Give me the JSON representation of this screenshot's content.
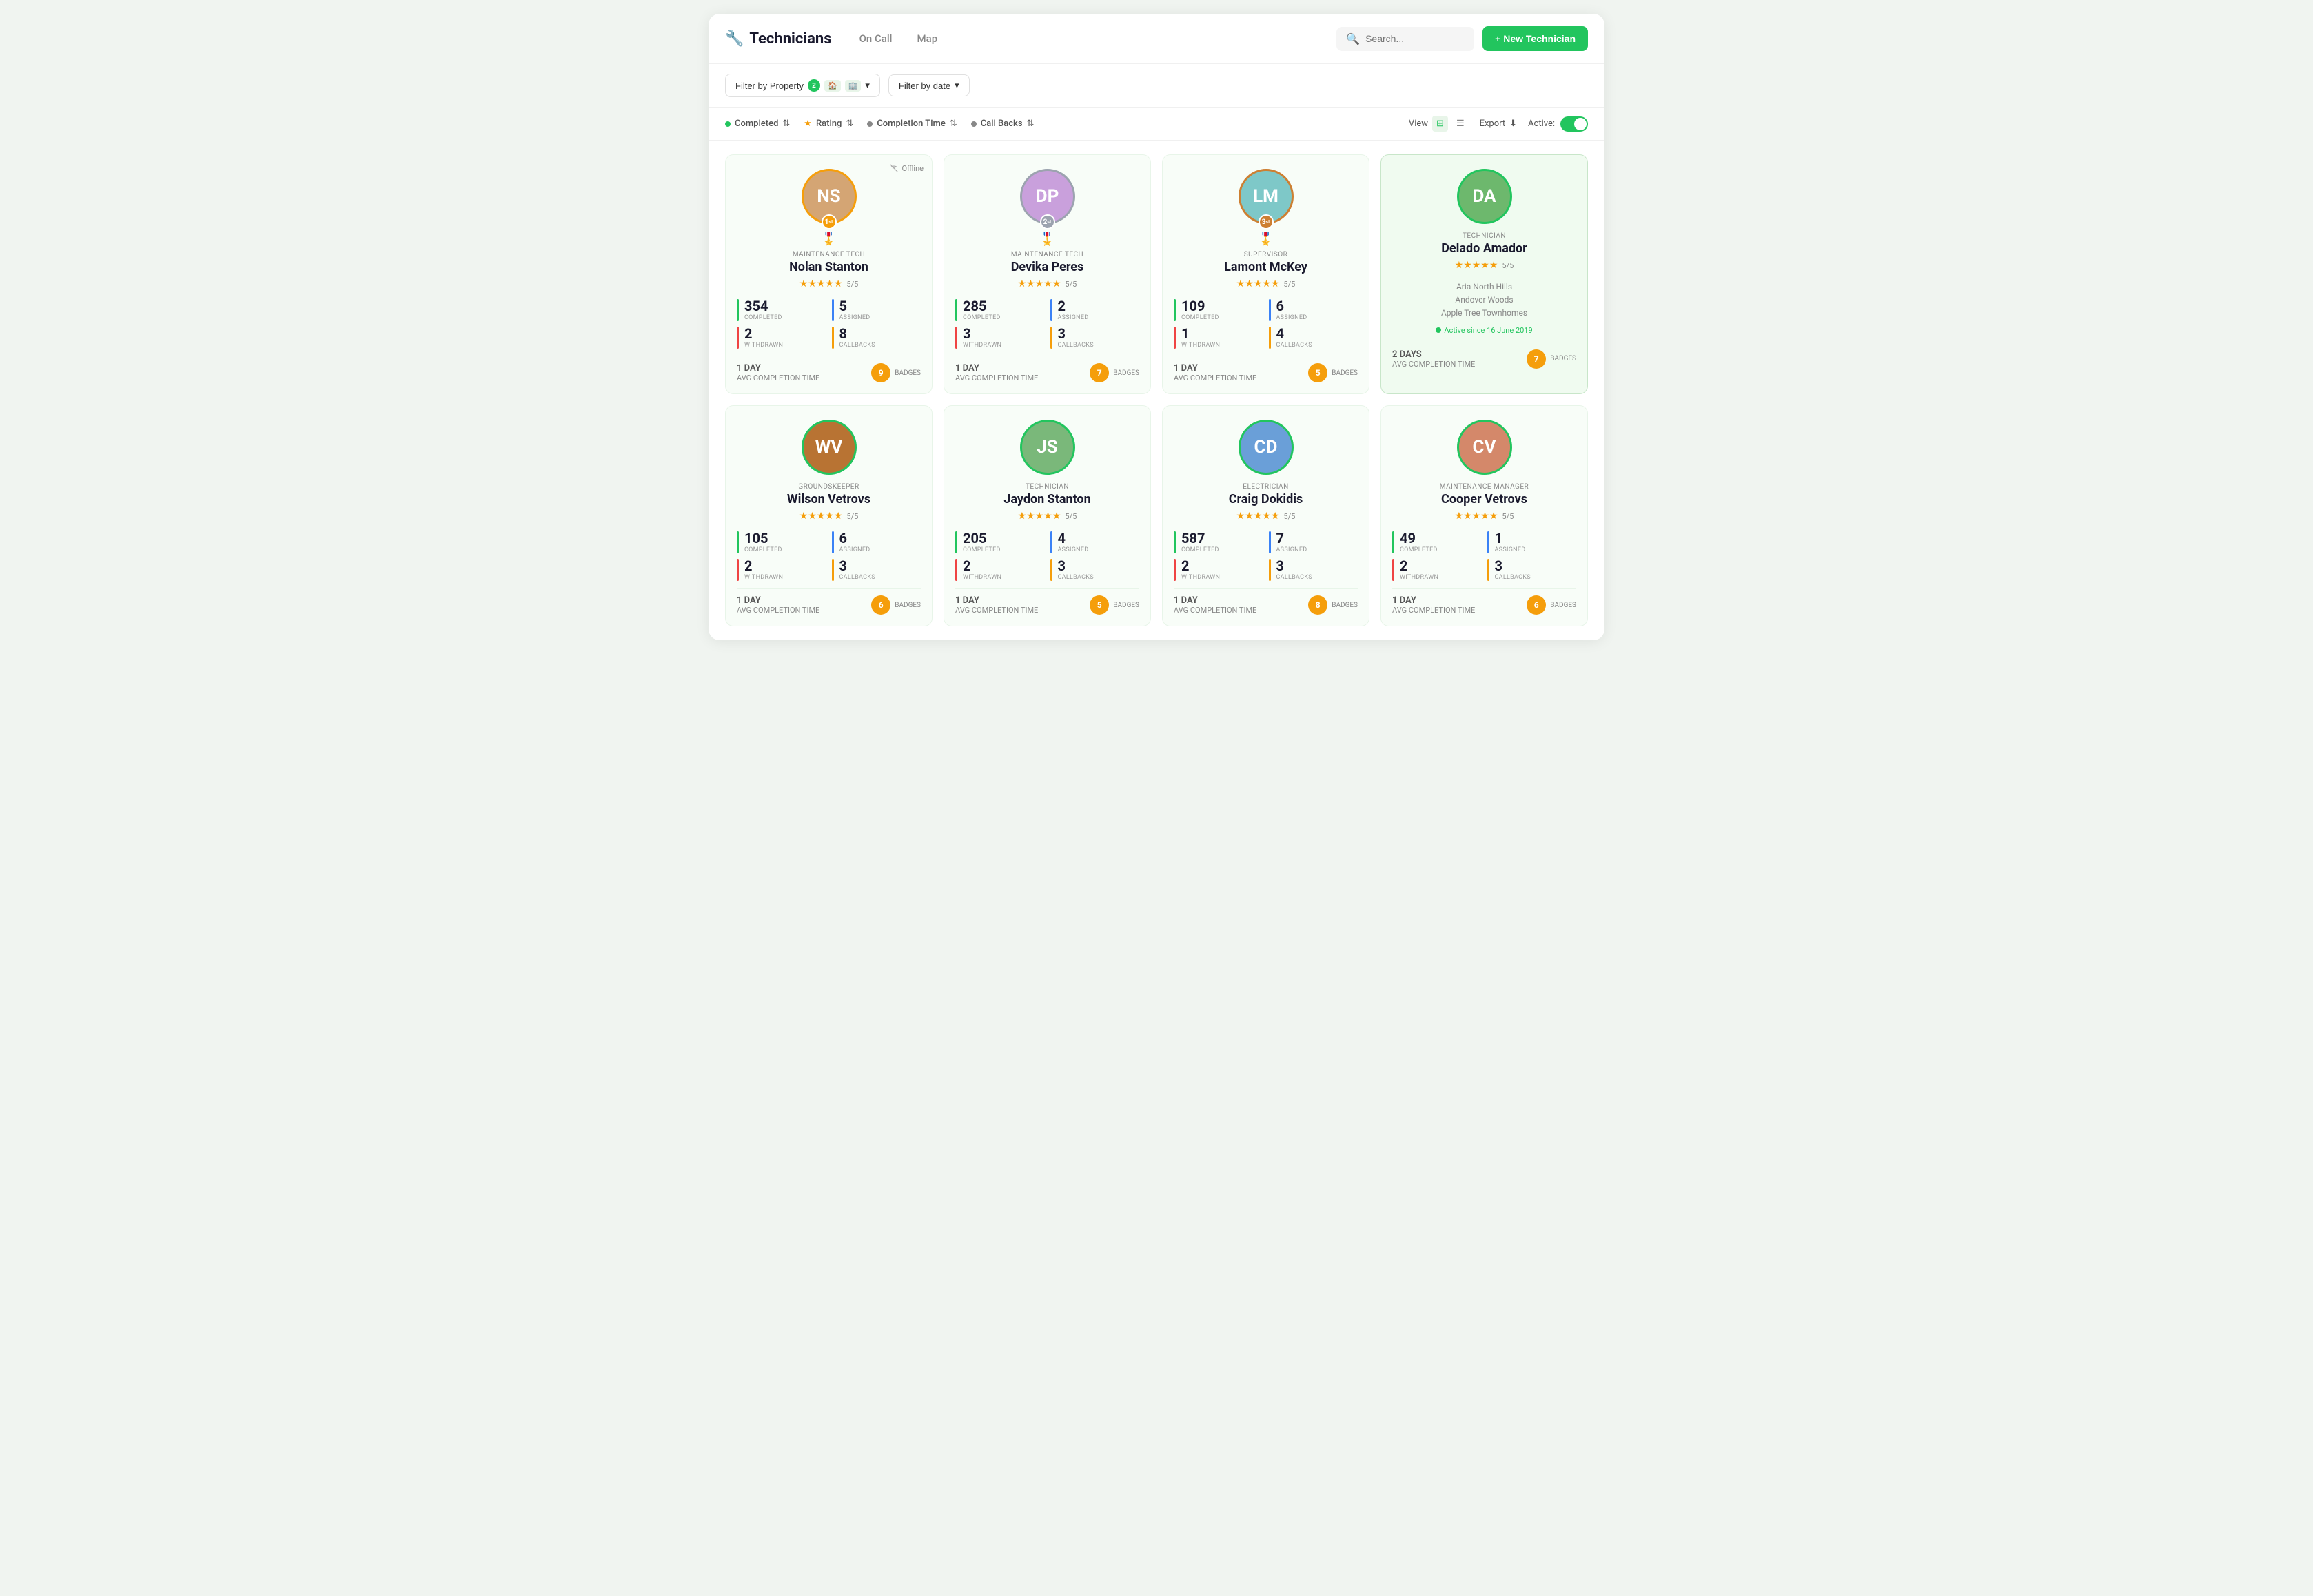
{
  "app": {
    "title": "Technicians",
    "logo_symbol": "🔧",
    "nav": [
      "On Call",
      "Map"
    ],
    "search_placeholder": "Search...",
    "new_tech_btn": "+ New Technician"
  },
  "filters": {
    "property_label": "Filter by Property",
    "property_count": "2",
    "date_label": "Filter by date"
  },
  "sort": {
    "completed_label": "Completed",
    "rating_label": "Rating",
    "completion_time_label": "Completion Time",
    "callbacks_label": "Call Backs",
    "view_label": "View",
    "export_label": "Export",
    "active_label": "Active:"
  },
  "technicians": [
    {
      "rank": 1,
      "role": "MAINTENANCE TECH",
      "name": "Nolan Stanton",
      "rating": "5/5",
      "stars": 5,
      "completed": 354,
      "assigned": 5,
      "withdrawn": 2,
      "callbacks": 8,
      "avg_completion": "1 DAY",
      "badges": 9,
      "status": "offline",
      "avatar_color": "#d4a574",
      "avatar_initials": "NS"
    },
    {
      "rank": 2,
      "role": "MAINTENANCE TECH",
      "name": "Devika Peres",
      "rating": "5/5",
      "stars": 5,
      "completed": 285,
      "assigned": 2,
      "withdrawn": 3,
      "callbacks": 3,
      "avg_completion": "1 DAY",
      "badges": 7,
      "status": "online",
      "avatar_color": "#b0c4de",
      "avatar_initials": "DP"
    },
    {
      "rank": 3,
      "role": "SUPERVISOR",
      "name": "Lamont McKey",
      "rating": "5/5",
      "stars": 5,
      "completed": 109,
      "assigned": 6,
      "withdrawn": 1,
      "callbacks": 4,
      "avg_completion": "1 DAY",
      "badges": 5,
      "status": "online",
      "avatar_color": "#8fbc8f",
      "avatar_initials": "LM"
    },
    {
      "rank": 0,
      "role": "TECHNICIAN",
      "name": "Delado Amador",
      "rating": "5/5",
      "stars": 5,
      "completed": null,
      "assigned": null,
      "withdrawn": null,
      "callbacks": null,
      "avg_completion": "2 DAYS",
      "badges": 7,
      "status": "active",
      "properties": [
        "Aria North Hills",
        "Andover Woods",
        "Apple Tree Townhomes"
      ],
      "active_since": "Active since 16 June 2019",
      "avatar_color": "#4a7c59",
      "avatar_initials": "DA"
    },
    {
      "rank": 0,
      "role": "GROUNDSKEEPER",
      "name": "Wilson Vetrovs",
      "rating": "5/5",
      "stars": 5,
      "completed": 105,
      "assigned": 6,
      "withdrawn": 2,
      "callbacks": 3,
      "avg_completion": "1 DAY",
      "badges": 6,
      "status": "online",
      "avatar_color": "#8b7355",
      "avatar_initials": "WV"
    },
    {
      "rank": 0,
      "role": "TECHNICIAN",
      "name": "Jaydon Stanton",
      "rating": "5/5",
      "stars": 5,
      "completed": 205,
      "assigned": 4,
      "withdrawn": 2,
      "callbacks": 3,
      "avg_completion": "1 DAY",
      "badges": 5,
      "status": "online",
      "avatar_color": "#5b8a6b",
      "avatar_initials": "JS"
    },
    {
      "rank": 0,
      "role": "ELECTRICIAN",
      "name": "Craig Dokidis",
      "rating": "5/5",
      "stars": 5,
      "completed": 587,
      "assigned": 7,
      "withdrawn": 2,
      "callbacks": 3,
      "avg_completion": "1 DAY",
      "badges": 8,
      "status": "online",
      "avatar_color": "#4a6fa5",
      "avatar_initials": "CD"
    },
    {
      "rank": 0,
      "role": "MAINTENANCE MANAGER",
      "name": "Cooper Vetrovs",
      "rating": "5/5",
      "stars": 5,
      "completed": 49,
      "assigned": 1,
      "withdrawn": 2,
      "callbacks": 3,
      "avg_completion": "1 DAY",
      "badges": 6,
      "status": "online",
      "avatar_color": "#c17f5d",
      "avatar_initials": "CV"
    }
  ]
}
